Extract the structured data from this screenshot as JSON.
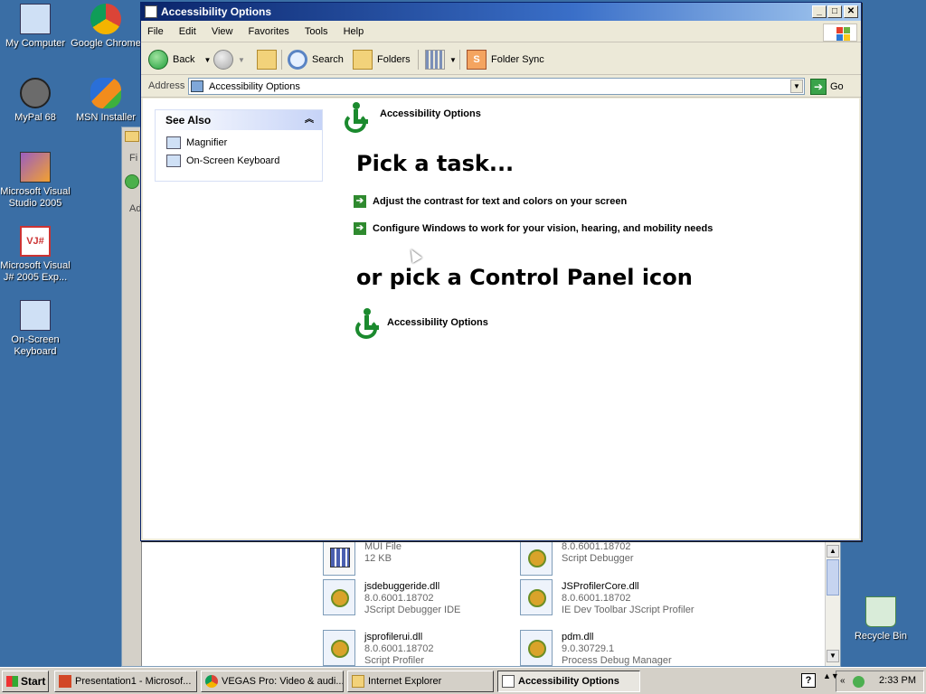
{
  "desktop": {
    "icons": [
      {
        "label": "My Computer"
      },
      {
        "label": "Google Chrome"
      },
      {
        "label": "MyPal 68"
      },
      {
        "label": "MSN Installer"
      },
      {
        "label": "Microsoft Visual Studio 2005"
      },
      {
        "label": "Microsoft Visual J# 2005 Exp..."
      },
      {
        "label": "On-Screen Keyboard"
      },
      {
        "label": "Recycle Bin"
      }
    ]
  },
  "background_window": {
    "strip_texts": [
      "Fi",
      "Ad"
    ],
    "files": [
      {
        "name": "",
        "line2": "MUI File",
        "line3": "12 KB",
        "icon": "mui-file-icon"
      },
      {
        "name": "",
        "line2": "8.0.6001.18702",
        "line3": "Script Debugger",
        "icon": "dll-gear-icon"
      },
      {
        "name": "jsdebuggeride.dll",
        "line2": "8.0.6001.18702",
        "line3": "JScript Debugger IDE",
        "icon": "dll-gear-icon"
      },
      {
        "name": "JSProfilerCore.dll",
        "line2": "8.0.6001.18702",
        "line3": "IE Dev Toolbar JScript Profiler",
        "icon": "dll-gear-icon"
      },
      {
        "name": "jsprofilerui.dll",
        "line2": "8.0.6001.18702",
        "line3": "Script Profiler",
        "icon": "dll-gear-icon"
      },
      {
        "name": "pdm.dll",
        "line2": "9.0.30729.1",
        "line3": "Process Debug Manager",
        "icon": "dll-gear-icon"
      }
    ]
  },
  "window": {
    "title": "Accessibility Options",
    "menu": [
      "File",
      "Edit",
      "View",
      "Favorites",
      "Tools",
      "Help"
    ],
    "toolbar": {
      "back": "Back",
      "search": "Search",
      "folders": "Folders",
      "folder_sync": "Folder Sync"
    },
    "address": {
      "label": "Address",
      "value": "Accessibility Options",
      "go": "Go"
    },
    "see_also": {
      "title": "See Also",
      "items": [
        "Magnifier",
        "On-Screen Keyboard"
      ]
    },
    "header_title": "Accessibility Options",
    "pick_task": "Pick a task...",
    "tasks": [
      "Adjust the contrast for text and colors on your screen",
      "Configure Windows to work for your vision, hearing, and mobility needs"
    ],
    "pick_icon": "or pick a Control Panel icon",
    "icon_label": "Accessibility Options"
  },
  "taskbar": {
    "start": "Start",
    "buttons": [
      "Presentation1 - Microsof...",
      "VEGAS Pro: Video & audi...",
      "Internet Explorer",
      "Accessibility Options"
    ],
    "clock": "2:33 PM"
  },
  "colors": {
    "desktop": "#3a6ea5",
    "title_gradient_start": "#0a246a",
    "accessibility_green": "#1b8a2e"
  }
}
